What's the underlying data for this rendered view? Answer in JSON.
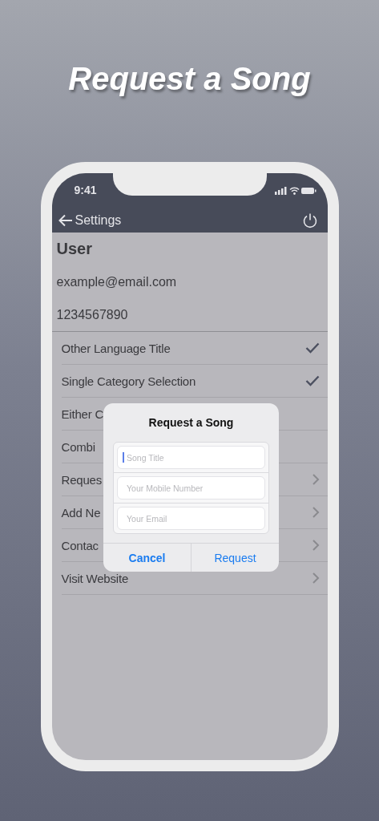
{
  "headline": "Request a Song",
  "status_bar": {
    "time": "9:41"
  },
  "nav": {
    "back_label": "Settings"
  },
  "user": {
    "title": "User",
    "email": "example@email.com",
    "phone": "1234567890"
  },
  "settings": [
    {
      "label": "Other Language Title",
      "kind": "toggle",
      "checked": true
    },
    {
      "label": "Single Category Selection",
      "kind": "toggle",
      "checked": true
    },
    {
      "label": "Either C",
      "kind": "toggle",
      "checked": false
    },
    {
      "label": "Combi",
      "kind": "toggle",
      "checked": false
    },
    {
      "label": "Reques",
      "kind": "link"
    },
    {
      "label": "Add Ne",
      "kind": "link"
    },
    {
      "label": "Contac",
      "kind": "link"
    },
    {
      "label": "Visit Website",
      "kind": "link"
    }
  ],
  "dialog": {
    "title": "Request a Song",
    "fields": [
      {
        "placeholder": "Song Title",
        "focused": true
      },
      {
        "placeholder": "Your Mobile Number",
        "focused": false
      },
      {
        "placeholder": "Your Email",
        "focused": false
      }
    ],
    "buttons": [
      {
        "label": "Cancel",
        "kind": "cancel"
      },
      {
        "label": "Request",
        "kind": "default"
      }
    ]
  }
}
